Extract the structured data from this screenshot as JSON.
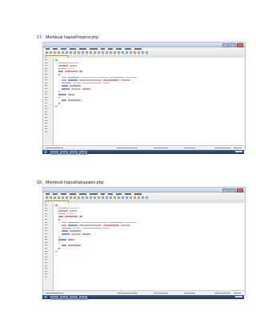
{
  "steps": [
    {
      "number": "17.",
      "title": "Membuat hapusPropinsi.php"
    },
    {
      "number": "18.",
      "title": "Membuat hapusKabupaten.php"
    }
  ],
  "colors": {
    "page_background": "#ffffff",
    "editor_background": "#ffffff",
    "tab_active": "#fff6c8",
    "code_keyword": "#1a3fb3",
    "code_string": "#7f7f7f",
    "code_variable": "#c04040",
    "taskbar": "#2a4670"
  }
}
